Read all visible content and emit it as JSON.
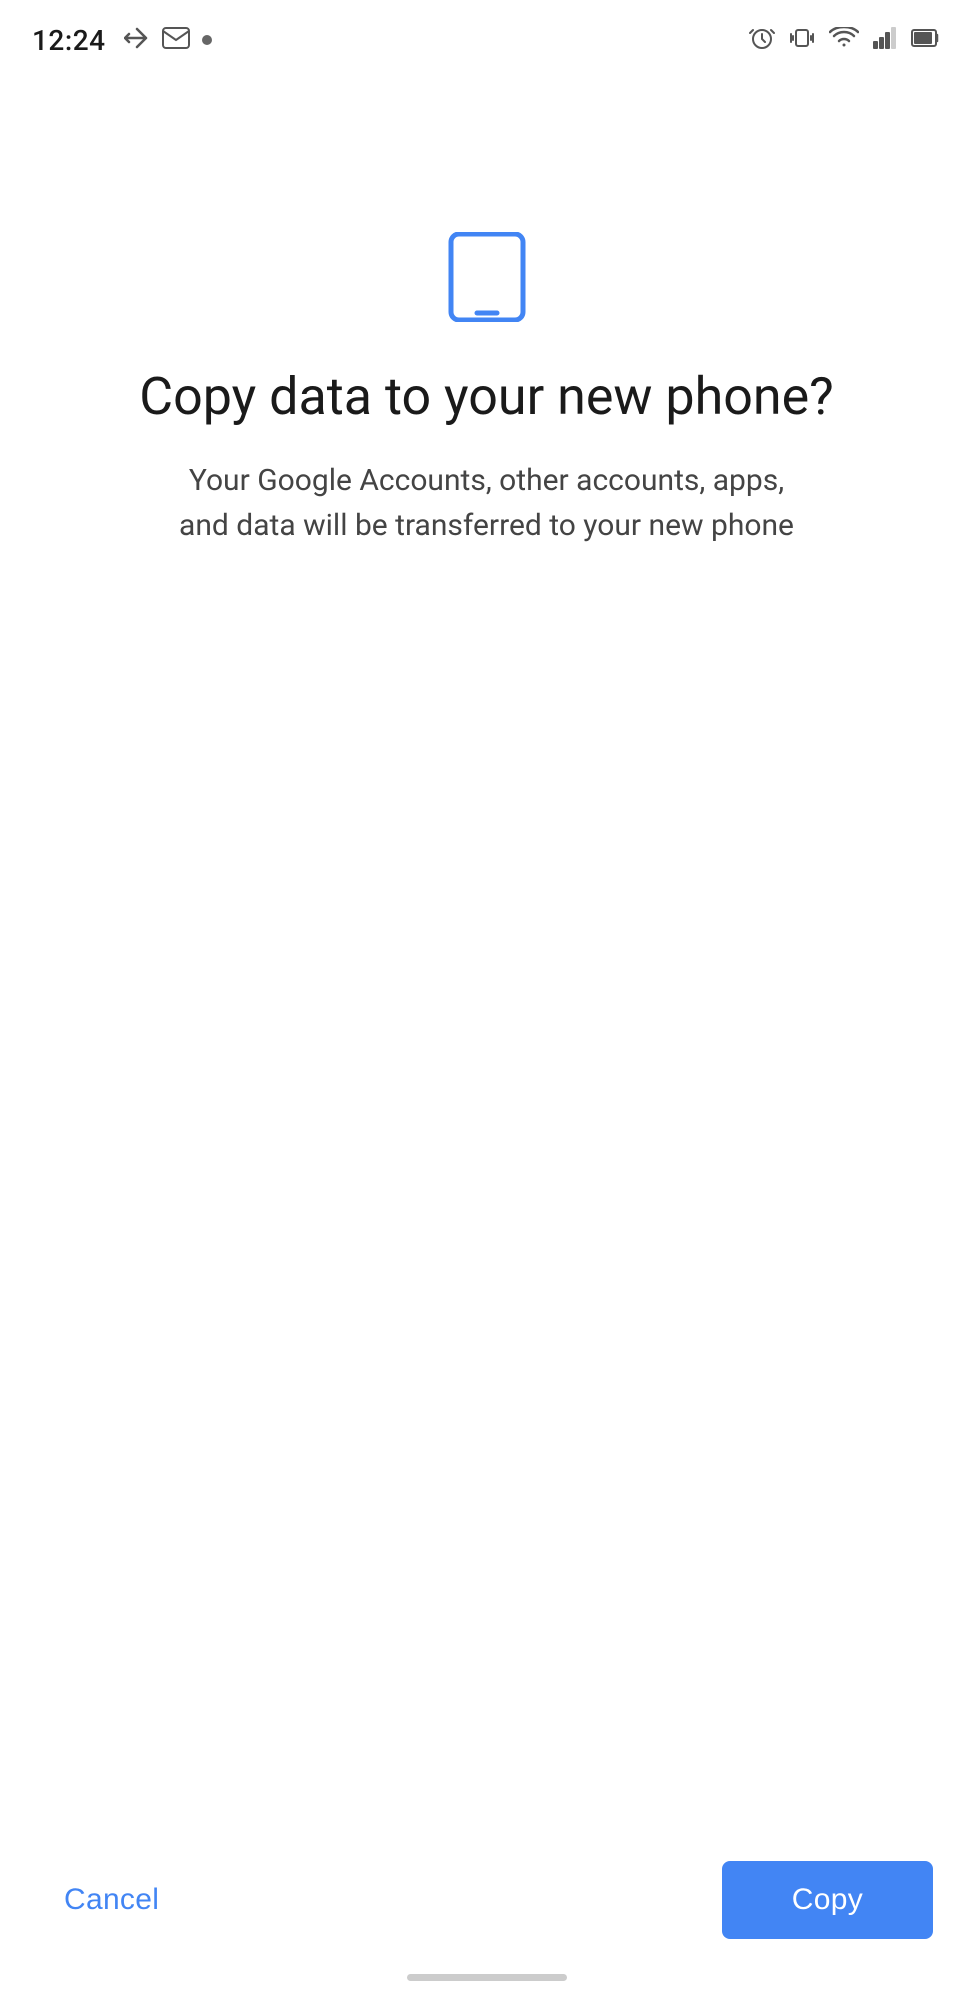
{
  "statusBar": {
    "time": "12:24",
    "icons": {
      "alarm": "⏰",
      "vibrate": "📳",
      "wifi": "wifi",
      "signal": "signal",
      "battery": "battery"
    }
  },
  "page": {
    "phoneIcon": "📱",
    "title": "Copy data to your new phone?",
    "subtitle": "Your Google Accounts, other accounts, apps, and data will be transferred to your new phone"
  },
  "actions": {
    "cancel_label": "Cancel",
    "copy_label": "Copy"
  },
  "colors": {
    "accent": "#4285f4",
    "text_primary": "#1a1a1a",
    "text_secondary": "#444444",
    "button_bg": "#4285f4",
    "button_text": "#ffffff"
  }
}
